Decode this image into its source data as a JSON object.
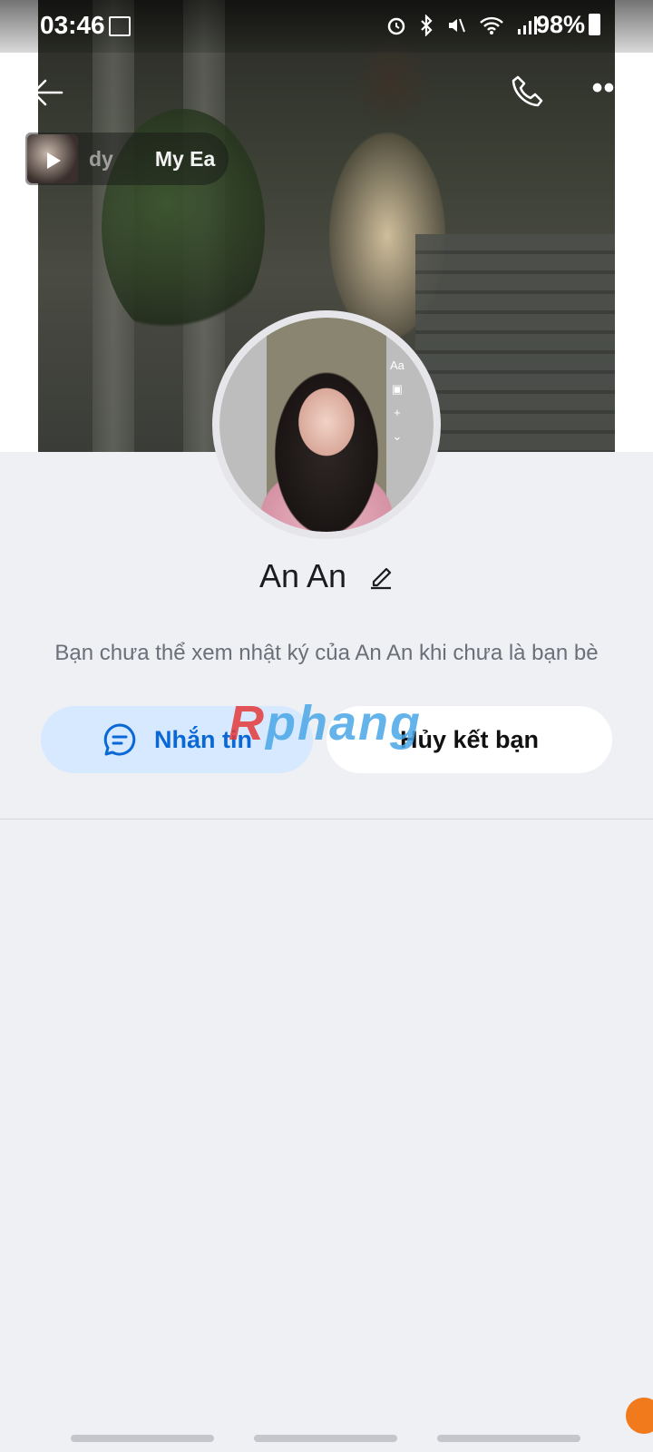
{
  "status_bar": {
    "time": "03:46",
    "battery": "98%",
    "icons": [
      "image-icon",
      "alarm-icon",
      "bluetooth-icon",
      "mute-icon",
      "wifi-icon",
      "signal-icon",
      "battery-icon"
    ]
  },
  "header": {
    "back_icon": "arrow-left-icon",
    "call_icon": "phone-icon",
    "more_icon": "more-horizontal-icon",
    "more_glyph": "•••"
  },
  "music": {
    "title_faded": "dy",
    "title": "My Ea"
  },
  "avatar_tools": [
    "Aa",
    "▣",
    "+",
    "⌄"
  ],
  "profile": {
    "name": "An An",
    "note": "Bạn chưa thể xem nhật ký của An An khi chưa là bạn bè"
  },
  "actions": {
    "message_label": "Nhắn tin",
    "unfriend_label": "Hủy kết bạn"
  },
  "watermark": {
    "first": "R",
    "rest": "phang"
  },
  "colors": {
    "accent": "#0a68d6",
    "message_bg": "#d6e9ff",
    "page_bg": "#eff0f4",
    "fab": "#f07a1c"
  }
}
